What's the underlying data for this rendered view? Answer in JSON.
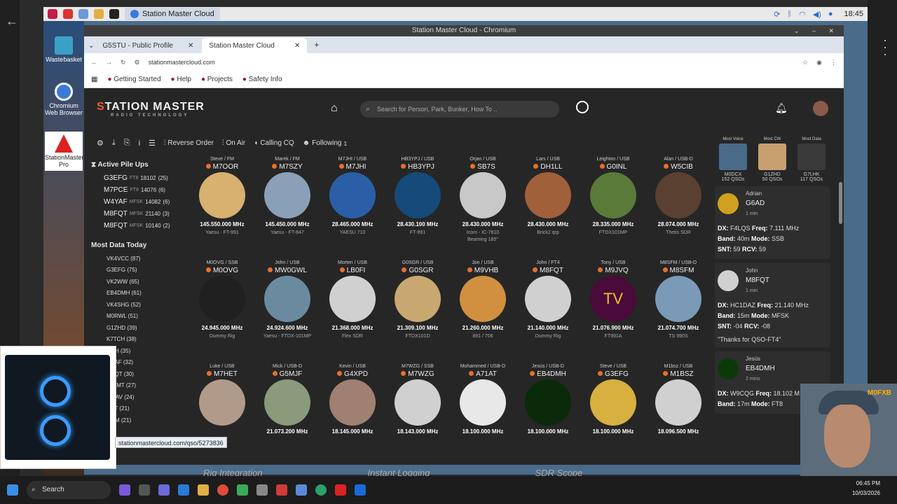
{
  "os": {
    "task_title": "Station Master Cloud",
    "clock": "18:45"
  },
  "desktop": {
    "icons": [
      {
        "label": "Wastebasket"
      },
      {
        "label": "Chromium Web Browser"
      },
      {
        "label": "StationMaster Pro"
      }
    ]
  },
  "browser": {
    "window_title": "Station Master Cloud - Chromium",
    "tabs": [
      {
        "label": "G5STU - Public Profile"
      },
      {
        "label": "Station Master Cloud"
      }
    ],
    "url": "stationmastercloud.com",
    "bookmarks": [
      "Getting Started",
      "Help",
      "Projects",
      "Safety Info"
    ]
  },
  "app": {
    "logo_main": "TATION MASTER",
    "logo_s": "S",
    "logo_sub": "RADIO TECHNOLOGY",
    "search_placeholder": "Search for Person, Park, Bunker, How To ..",
    "toolbar": {
      "reverse": "Reverse Order",
      "onair": "On Air",
      "cq": "Calling CQ",
      "following": "Following",
      "following_count": "1"
    },
    "pileups_title": "Active Pile Ups",
    "pileups": [
      {
        "call": "G3EFG",
        "mode": "FT8",
        "freq": "18102",
        "count": "(25)"
      },
      {
        "call": "M7PCE",
        "mode": "FT8",
        "freq": "14076",
        "count": "(6)"
      },
      {
        "call": "W4YAF",
        "mode": "MFSK",
        "freq": "14082",
        "count": "(6)"
      },
      {
        "call": "M8FQT",
        "mode": "MFSK",
        "freq": "21140",
        "count": "(3)"
      },
      {
        "call": "M8FQT",
        "mode": "MFSK",
        "freq": "10140",
        "count": "(2)"
      }
    ],
    "mostdata_title": "Most Data Today",
    "mostdata": [
      "VK4VCC (87)",
      "G3EFG (75)",
      "VK2WW (65)",
      "EB4DMH (61)",
      "VK4SHG (52)",
      "M0RWL (51)",
      "G1ZHD (39)",
      "K7TCH (38)",
      "...VH (35)",
      "...YAF (32)",
      "...FQT (30)",
      "...WMT (27)",
      "...GAV (24)",
      "...AT (21)",
      "...SM (21)"
    ],
    "cards": [
      {
        "op": "Steve / FM",
        "call": "M7OOR",
        "freq": "145.550.000 MHz",
        "rig": "Yaesu - FT-991",
        "bg": "#d8b070"
      },
      {
        "op": "Marek / FM",
        "call": "M7SZY",
        "freq": "145.450.000 MHz",
        "rig": "Yaesu - FT-847",
        "bg": "#8aa0b8"
      },
      {
        "op": "M7JHI / USB",
        "call": "M7JHI",
        "freq": "28.465.000 MHz",
        "rig": "YAESU 710",
        "bg": "#2a5fa8"
      },
      {
        "op": "HB3YPJ / USB",
        "call": "HB3YPJ",
        "freq": "28.430.100 MHz",
        "rig": "FT-991",
        "bg": "#154a7a"
      },
      {
        "op": "Orjan / USB",
        "call": "SB7S",
        "freq": "28.430.000 MHz",
        "rig": "Icom - IC-7610",
        "extra": "Beaming 185°",
        "bg": "#c8c8c8"
      },
      {
        "op": "Lars / USB",
        "call": "DH1LL",
        "freq": "28.430.000 MHz",
        "rig": "Brick2 qrp",
        "bg": "#a0603a"
      },
      {
        "op": "Leighton / USB",
        "call": "G0INL",
        "freq": "28.335.000 MHz",
        "rig": "FTDX101MP",
        "bg": "#5a7a3a"
      },
      {
        "op": "Alan / USB-D",
        "call": "W5CIB",
        "freq": "28.074.000 MHz",
        "rig": "Thetis SDR",
        "bg": "#5a4030"
      },
      {
        "op": "M0OVG / SSB",
        "call": "M0OVG",
        "freq": "24.945.000 MHz",
        "rig": "Dummy Rig",
        "bg": "#202020"
      },
      {
        "op": "John / USB",
        "call": "MW0GWL",
        "freq": "24.924.600 MHz",
        "rig": "Yaesu - FTDX-101MP",
        "bg": "#6a8aa0"
      },
      {
        "op": "Morten / USB",
        "call": "LB0FI",
        "freq": "21.368.000 MHz",
        "rig": "Flex SDR",
        "bg": "#d0d0d0"
      },
      {
        "op": "G0SGR / USB",
        "call": "G0SGR",
        "freq": "21.309.100 MHz",
        "rig": "FTDX101D",
        "bg": "#c8a870"
      },
      {
        "op": "Jon / USB",
        "call": "M9VHB",
        "freq": "21.260.000 MHz",
        "rig": "891 / 706",
        "bg": "#d09040"
      },
      {
        "op": "John / FT4",
        "call": "M8FQT",
        "freq": "21.140.000 MHz",
        "rig": "Dummy Rig",
        "bg": "#d0d0d0"
      },
      {
        "op": "Tony / USB",
        "call": "M9JVQ",
        "freq": "21.076.900 MHz",
        "rig": "FT991A",
        "bg": "#4a0a3a",
        "txt": "TV"
      },
      {
        "op": "M8SFM / USB-D",
        "call": "M8SFM",
        "freq": "21.074.700 MHz",
        "rig": "TS 990S",
        "bg": "#7a9ab8"
      },
      {
        "op": "Luke / USB",
        "call": "M7HET",
        "freq": "",
        "rig": "",
        "bg": "#b09a8a"
      },
      {
        "op": "Mick / USB-D",
        "call": "G5MJF",
        "freq": "21.073.200 MHz",
        "rig": "",
        "bg": "#8a9a7a"
      },
      {
        "op": "Kevin / USB",
        "call": "G4XPD",
        "freq": "18.145.000 MHz",
        "rig": "",
        "bg": "#a08070"
      },
      {
        "op": "M7WZG / SSB",
        "call": "M7WZG",
        "freq": "18.143.000 MHz",
        "rig": "",
        "bg": "#d0d0d0"
      },
      {
        "op": "Mohammed / USB-D",
        "call": "A71AT",
        "freq": "18.100.000 MHz",
        "rig": "",
        "bg": "#e8e8e8"
      },
      {
        "op": "Jesús / USB-D",
        "call": "EB4DMH",
        "freq": "18.100.000 MHz",
        "rig": "",
        "bg": "#0a2a0a"
      },
      {
        "op": "Steve / USB",
        "call": "G3EFG",
        "freq": "18.100.000 MHz",
        "rig": "",
        "bg": "#d8b040"
      },
      {
        "op": "M1bsz / USB",
        "call": "M1BSZ",
        "freq": "18.096.500 MHz",
        "rig": "",
        "bg": "#d0d0d0"
      }
    ],
    "most": [
      {
        "label": "Most Voice",
        "call": "M0DCX",
        "count": "152 QSOs"
      },
      {
        "label": "Most CW",
        "call": "G1ZHD",
        "count": "50 QSOs"
      },
      {
        "label": "Most Data",
        "call": "G7LHK",
        "count": "117 QSOs"
      }
    ],
    "feed": [
      {
        "name": "Adrian",
        "call": "G6AD",
        "time": "1 min",
        "dx": "F4LQS",
        "freq": "7.111 MHz",
        "band": "40m",
        "mode": "SSB",
        "snt": "59",
        "rcv": "59",
        "note": ""
      },
      {
        "name": "John",
        "call": "M8FQT",
        "time": "1 min",
        "dx": "HC1DAZ",
        "freq": "21.140 MHz",
        "band": "15m",
        "mode": "MFSK",
        "snt": "-04",
        "rcv": "-08",
        "note": "\"Thanks for QSO-FT4\""
      },
      {
        "name": "Jesús",
        "call": "EB4DMH",
        "time": "2 mins",
        "dx": "W9CQG",
        "freq": "18.102 M",
        "band": "17m",
        "mode": "FT8",
        "snt": "",
        "rcv": "",
        "note": ""
      }
    ]
  },
  "status_url": "stationmastercloud.com/qso/5273836",
  "captions": [
    "Rig Integration",
    "Instant Logging",
    "SDR Scope"
  ],
  "cam_tag": "M0FXB",
  "taskbar": {
    "search": "Search",
    "time": "06:45 PM",
    "date": "10/03/2026"
  }
}
